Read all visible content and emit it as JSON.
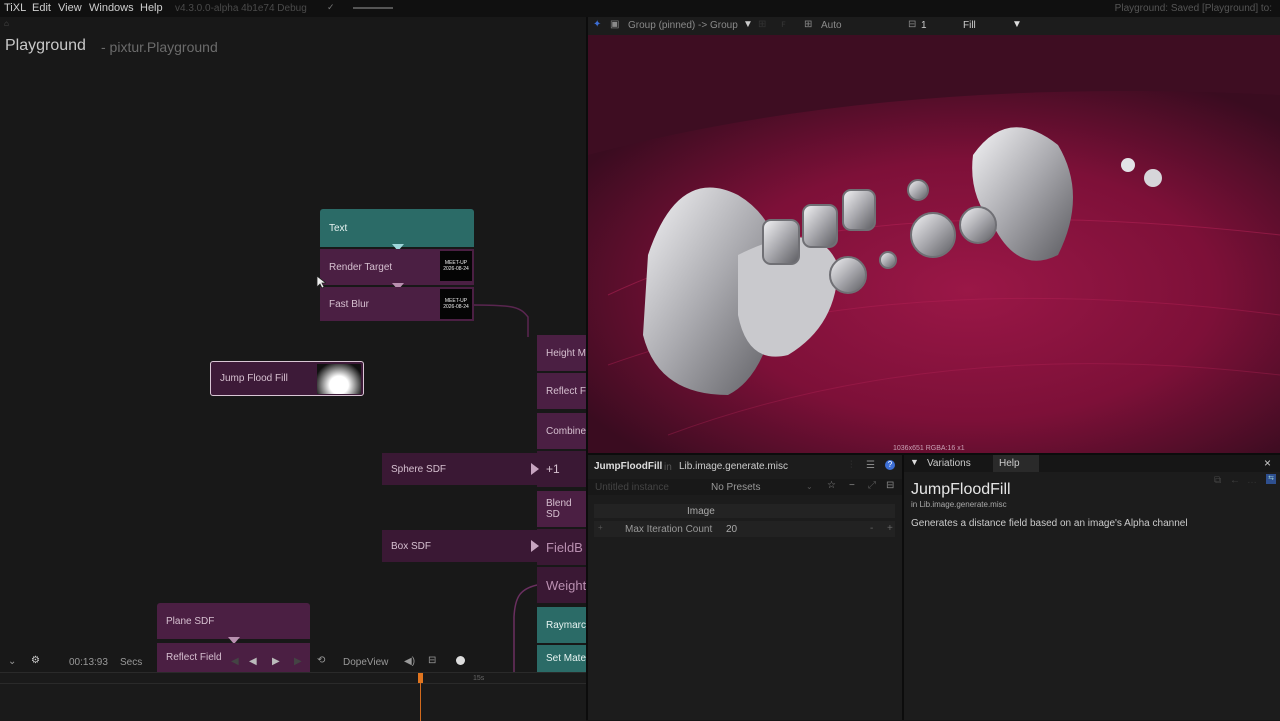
{
  "menubar": {
    "app": "TiXL",
    "items": [
      "Edit",
      "View",
      "Windows",
      "Help"
    ],
    "version": "v4.3.0.0-alpha 4b1e74 Debug",
    "status": "Playground: Saved [Playground] to:"
  },
  "graph": {
    "title": "Playground",
    "subtitle": "- pixtur.Playground",
    "nodes": {
      "text": "Text",
      "render_target": "Render Target",
      "fast_blur": "Fast Blur",
      "jump_flood_fill": "Jump Flood Fill",
      "height_map": "Height M",
      "reflect": "Reflect F",
      "combine": "Combine",
      "plus_one": "+1",
      "blend_sdf": "Blend SD",
      "field_b": "FieldB",
      "weight": "Weight",
      "raymarch": "Raymarc",
      "set_material": "Set Mate",
      "sphere_sdf": "Sphere SDF",
      "box_sdf": "Box SDF",
      "plane_sdf": "Plane SDF",
      "reflect_field": "Reflect Field"
    },
    "thumb_text": "MEET-UP 2026-08-24"
  },
  "transport": {
    "time": "00:13:93",
    "unit": "Secs",
    "mode": "DopeView",
    "timeline_marker": "15s"
  },
  "viewer": {
    "pin_label": "Group (pinned) -> Group",
    "camera": "Auto",
    "count": "1",
    "fill_mode": "Fill",
    "resolution": "1036x651  RGBA:16  x1"
  },
  "params": {
    "op_name": "JumpFloodFill",
    "in_word": "in",
    "namespace": "Lib.image.generate.misc",
    "instance_placeholder": "Untitled instance",
    "presets": "No Presets",
    "input_label": "Image",
    "param_label": "Max Iteration Count",
    "param_value": "20"
  },
  "help": {
    "tab_variations": "Variations",
    "tab_help": "Help",
    "title": "JumpFloodFill",
    "namespace": "in Lib.image.generate.misc",
    "description": "Generates a distance field based on an image's Alpha channel"
  },
  "colors": {
    "node_purple": "#4b1f43",
    "node_teal": "#2b6b67",
    "viewer_bg": "#3d0e22",
    "accent_blue": "#3d6fd6"
  }
}
